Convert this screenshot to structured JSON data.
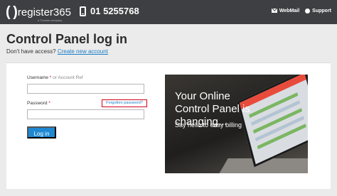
{
  "header": {
    "logo_text": "register365",
    "logo_tag": "a Tucows company",
    "phone_number": "01 5255768",
    "nav": [
      {
        "label": "WebMail",
        "icon": "mail-icon"
      },
      {
        "label": "Support",
        "icon": "support-icon"
      }
    ]
  },
  "main": {
    "title": "Control Panel log in",
    "no_access_text": "Don't have access?",
    "create_account_link": "Create new account"
  },
  "form": {
    "username_label": "Username",
    "username_required": "*",
    "username_hint": "or Account Ref",
    "username_value": "",
    "password_label": "Password",
    "password_required": "*",
    "password_value": "",
    "forgot_link": "Forgotten password?",
    "login_button": "Log in"
  },
  "banner": {
    "title": "Your Online Control Panel is changing...",
    "subtitle": "Say hello to easy billing"
  },
  "colors": {
    "topbar": "#3d3f42",
    "link": "#1b7fc7",
    "button": "#1e88d2",
    "highlight_border": "#d0021b"
  }
}
